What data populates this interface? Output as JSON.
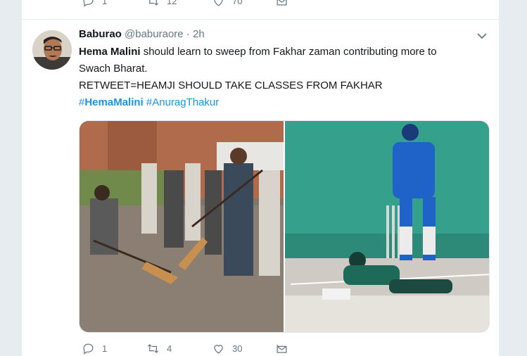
{
  "previous_tweet": {
    "actions": {
      "reply_count": "1",
      "retweet_count": "12",
      "like_count": "70"
    }
  },
  "tweet": {
    "author_name": "Baburao",
    "author_handle": "@baburaore",
    "separator": "·",
    "time": "2h",
    "text": {
      "mention": "Hema Malini",
      "line1_rest": " should learn to sweep from Fakhar zaman contributing more to",
      "line2": "Swach Bharat.",
      "line3": "RETWEET=HEAMJI SHOULD TAKE CLASSES FROM FAKHAR",
      "hash1_symbol": "#",
      "hash1_word": "HemaMalini",
      "hash2": "#AnuragThakur"
    },
    "media": {
      "left_photo": "person-sweeping-photo",
      "right_photo": "cricket-dive-photo"
    },
    "actions": {
      "reply_count": "1",
      "retweet_count": "4",
      "like_count": "30"
    }
  },
  "colors": {
    "link": "#1b95e0",
    "muted": "#657786",
    "text": "#14171a",
    "background": "#e6ecf0"
  },
  "icons": [
    "reply-icon",
    "retweet-icon",
    "like-icon",
    "message-icon",
    "chevron-down-icon"
  ]
}
